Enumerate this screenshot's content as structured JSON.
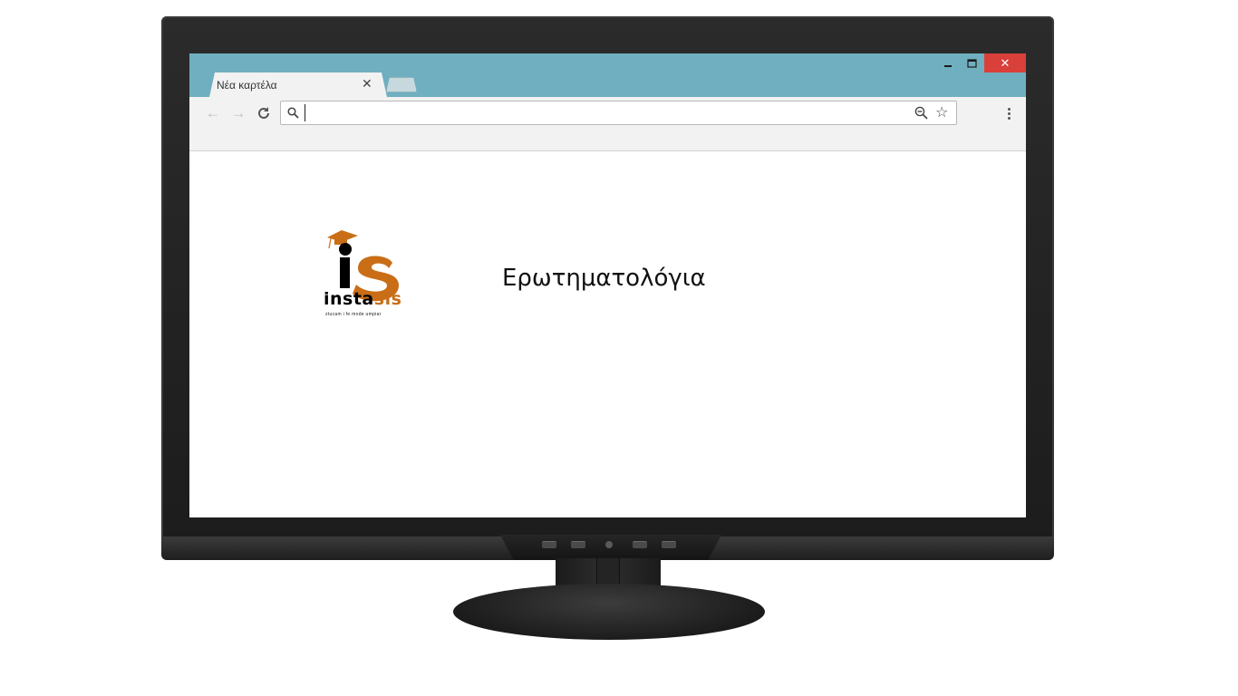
{
  "browser": {
    "tab_title": "Νέα καρτέλα",
    "tab_close": "✕",
    "window_controls": {
      "minimize": "–",
      "maximize": "□",
      "close": "✕"
    },
    "nav": {
      "back": "←",
      "forward": "→",
      "reload": "⟳"
    },
    "address_value": "",
    "star": "☆"
  },
  "page": {
    "logo": {
      "word_main": "insta",
      "word_accent": "sis",
      "tagline": "ztucam i fe mode umpiar"
    },
    "heading": "Ερωτηματολόγια"
  },
  "colors": {
    "titlebar": "#6fafbf",
    "logo_accent": "#c96e17",
    "close_button": "#d9403a"
  },
  "icons": [
    "search-icon",
    "zoom-out-icon",
    "star-icon",
    "menu-icon",
    "back-arrow-icon",
    "forward-arrow-icon",
    "reload-icon",
    "graduation-cap-icon"
  ]
}
